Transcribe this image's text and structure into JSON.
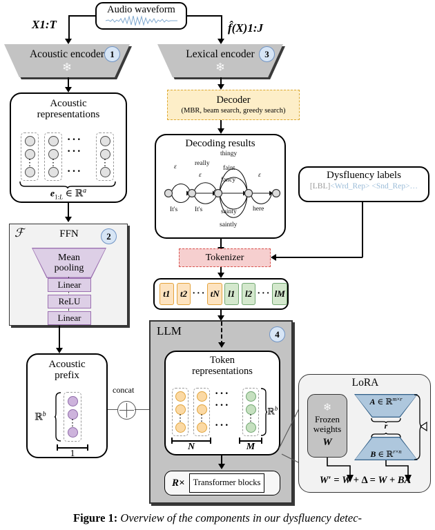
{
  "figure": {
    "caption_prefix": "Figure 1:",
    "caption_text": "Overview of the components in our dysfluency detec-"
  },
  "nodes": {
    "audio_waveform": {
      "title": "Audio waveform",
      "icon": "waveform-icon"
    },
    "acoustic_encoder": {
      "label": "Acoustic encoder",
      "step": "1",
      "icon": "snowflake-icon"
    },
    "lexical_encoder": {
      "label": "Lexical encoder",
      "step": "3",
      "icon": "snowflake-icon"
    },
    "acoustic_representations": {
      "title_line1": "Acoustic",
      "title_line2": "representations",
      "formula": "e1:L ∈ ℝa"
    },
    "decoder": {
      "title": "Decoder",
      "subtitle": "(MBR, beam search, greedy search)"
    },
    "decoding_results": {
      "title": "Decoding results"
    },
    "dysfluency_labels": {
      "title": "Dysfluency labels",
      "prefix": "[LBL]",
      "tags": "<Wrd_Rep> <Snd_Rep>…"
    },
    "tokenizer": {
      "title": "Tokenizer"
    },
    "ffn": {
      "title": "FFN",
      "symbol": "ℱ",
      "step": "2",
      "mean_pooling_line1": "Mean",
      "mean_pooling_line2": "pooling",
      "layers": [
        "Linear",
        "ReLU",
        "Linear"
      ]
    },
    "acoustic_prefix": {
      "title_line1": "Acoustic",
      "title_line2": "prefix",
      "dim_label": "ℝb",
      "count_label": "1"
    },
    "concat": {
      "label": "concat",
      "icon": "circle-plus-icon"
    },
    "llm": {
      "title": "LLM",
      "step": "4",
      "token_representations_line1": "Token",
      "token_representations_line2": "representations",
      "dim_label": "ℝb",
      "group_left": "N",
      "group_right": "M",
      "repeat": "R×",
      "transformer_blocks": "Transformer blocks"
    },
    "lora": {
      "title": "LoRA",
      "frozen_line1": "Frozen",
      "frozen_line2": "weights",
      "frozen_symbol": "W",
      "icon": "snowflake-icon",
      "matrix_a": "A ∈ ℝm×r",
      "matrix_b": "B ∈ ℝr×n",
      "rank_label": "r",
      "equation": "W′ = W + Δ = W + BA"
    }
  },
  "edges": {
    "x_input": "X1:T",
    "f_input": "f̂(X)1:J"
  },
  "tokens": {
    "text_tokens": [
      "t1",
      "t2",
      "tN"
    ],
    "label_tokens": [
      "l1",
      "l2",
      "lM"
    ],
    "ellipsis": "···"
  },
  "lattice": {
    "arcs_top": [
      "ε",
      "really",
      "thingy",
      "faint",
      "ε"
    ],
    "arcs_mid": [
      "ε",
      "fancy"
    ],
    "arcs_bottom": [
      "It's",
      "It's",
      "sainty",
      "saintly",
      "here"
    ]
  },
  "colors": {
    "encoder_fill": "#c3c3c3",
    "decoder_fill": "#fdeec8",
    "decoder_border": "#dca72c",
    "tokenizer_fill": "#f6cfcf",
    "tokenizer_border": "#d8534f",
    "token_text": "#e3a33c",
    "token_label": "#73a772",
    "violet": "#ddcfe6",
    "lora_blue": "#aec7dd",
    "step_badge": "#d7e5f5",
    "llm_fill": "#c3c3c3",
    "panel_fill": "#f2f2f2"
  }
}
